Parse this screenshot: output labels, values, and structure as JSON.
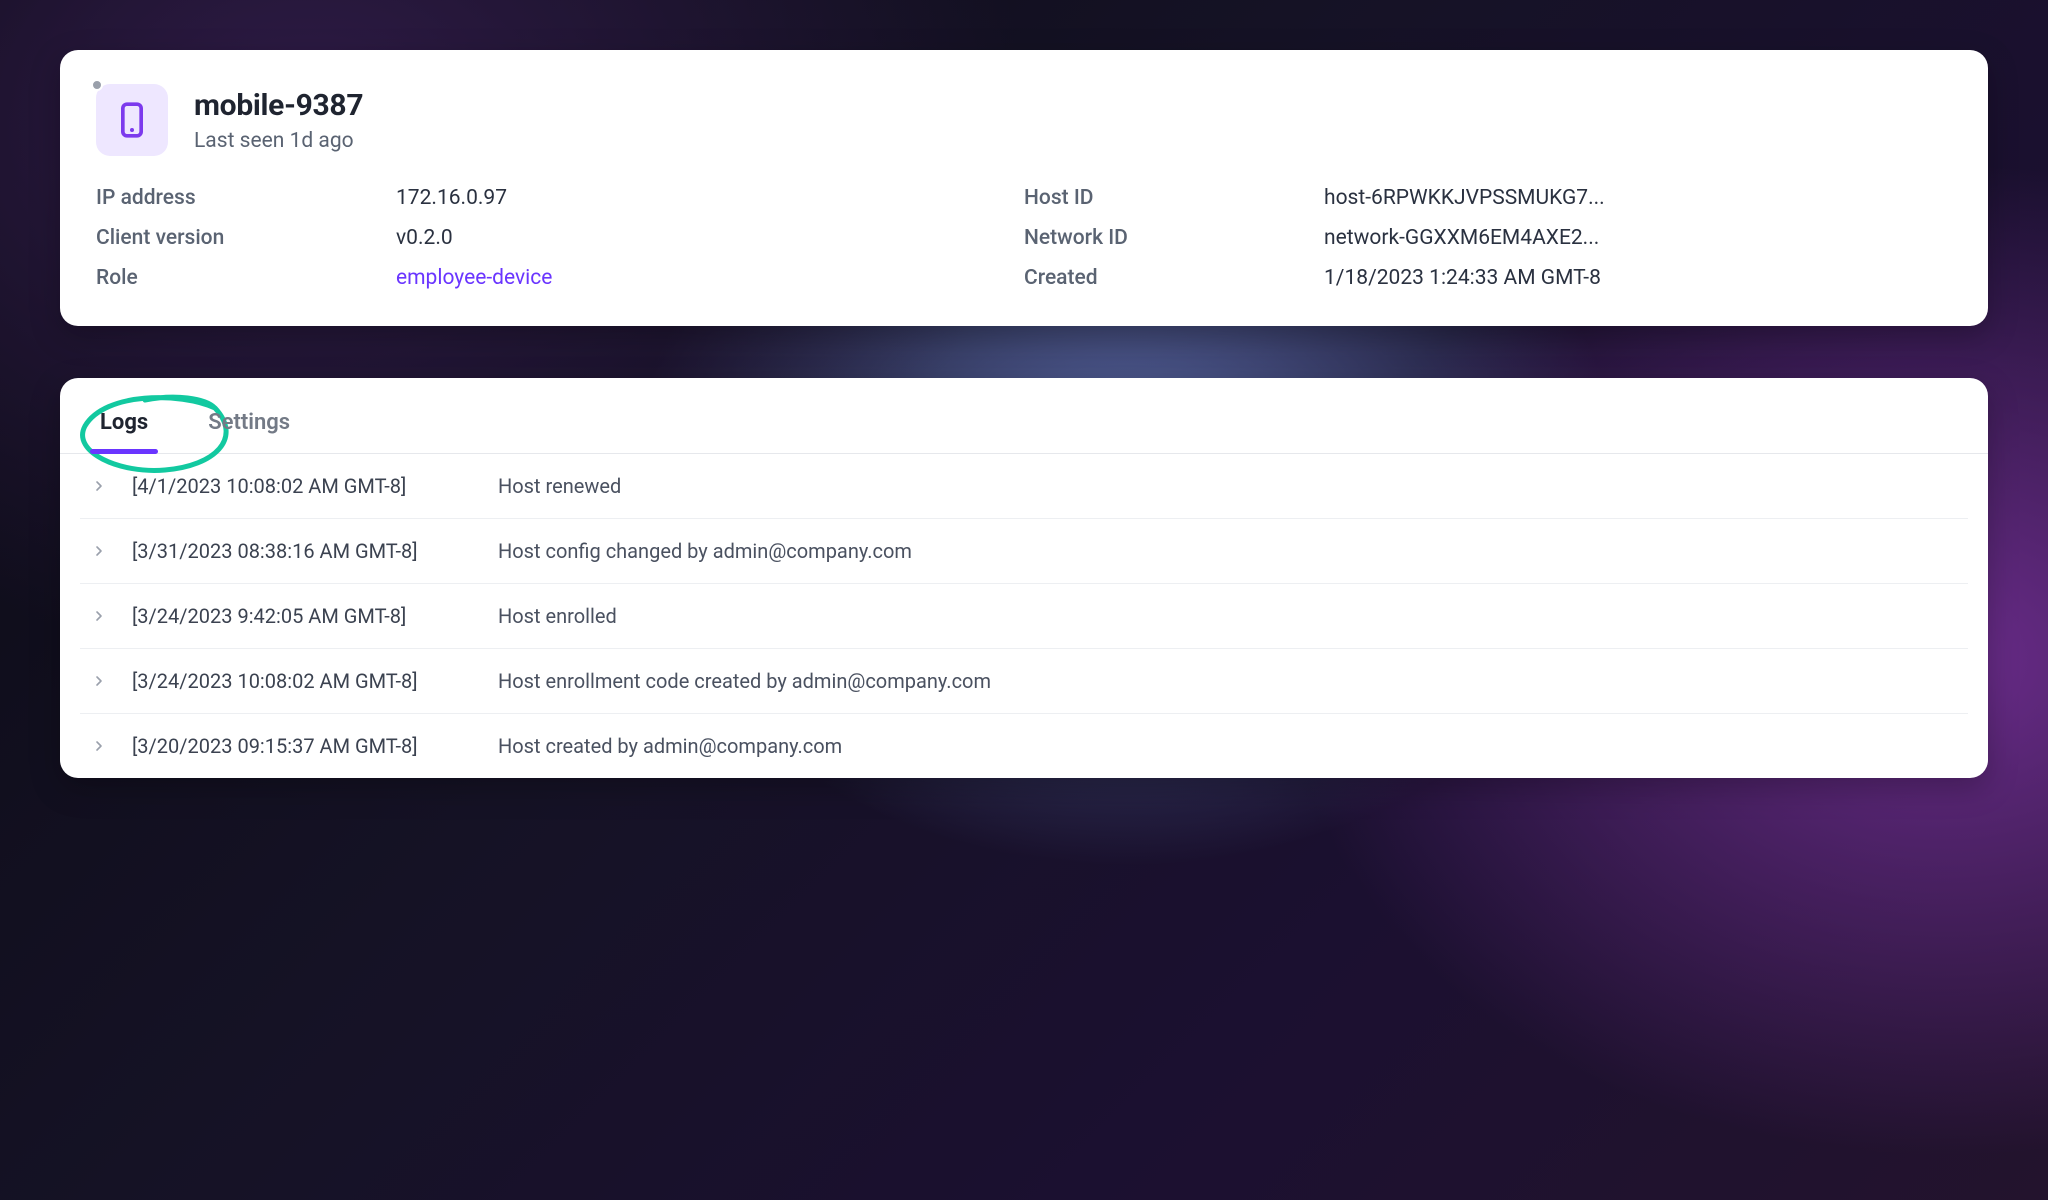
{
  "device": {
    "name": "mobile-9387",
    "last_seen": "Last seen 1d ago",
    "icon": "mobile-icon",
    "status": "offline"
  },
  "details": {
    "ip_address": {
      "label": "IP address",
      "value": "172.16.0.97"
    },
    "host_id": {
      "label": "Host ID",
      "value": "host-6RPWKKJVPSSMUKG7..."
    },
    "client_version": {
      "label": "Client version",
      "value": "v0.2.0"
    },
    "network_id": {
      "label": "Network ID",
      "value": "network-GGXXM6EM4AXE2..."
    },
    "role": {
      "label": "Role",
      "value": "employee-device"
    },
    "created": {
      "label": "Created",
      "value": "1/18/2023 1:24:33 AM GMT-8"
    }
  },
  "tabs": {
    "logs": "Logs",
    "settings": "Settings",
    "active": "logs"
  },
  "logs": [
    {
      "timestamp": "[4/1/2023 10:08:02 AM GMT-8]",
      "message": "Host renewed"
    },
    {
      "timestamp": "[3/31/2023 08:38:16 AM GMT-8]",
      "message": "Host config changed by admin@company.com"
    },
    {
      "timestamp": "[3/24/2023 9:42:05 AM GMT-8]",
      "message": "Host enrolled"
    },
    {
      "timestamp": "[3/24/2023 10:08:02 AM GMT-8]",
      "message": "Host enrollment code created by admin@company.com"
    },
    {
      "timestamp": "[3/20/2023 09:15:37 AM GMT-8]",
      "message": "Host created by admin@company.com"
    }
  ],
  "colors": {
    "accent": "#6a35ff",
    "scribble": "#12c9a0"
  }
}
